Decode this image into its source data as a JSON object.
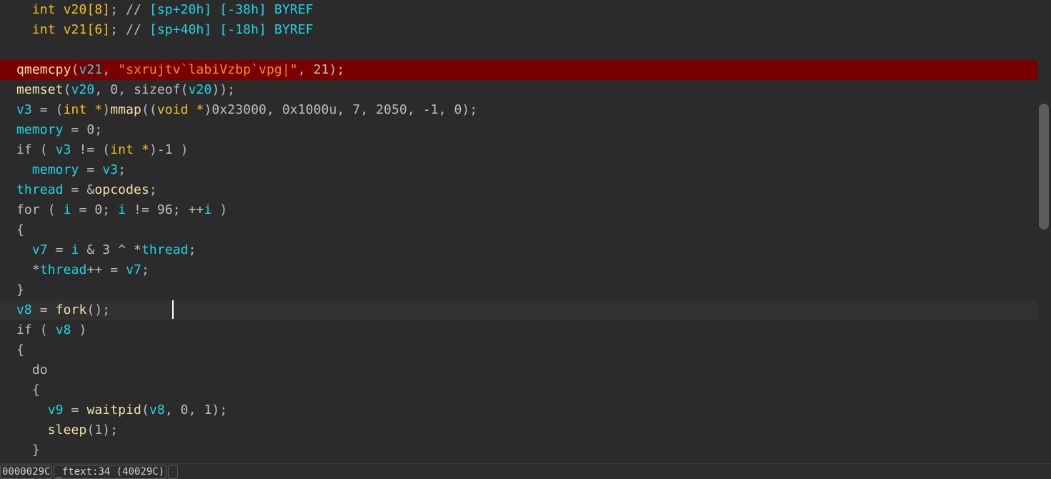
{
  "colors": {
    "keyword": "#f2c21a",
    "identifier": "#1fd6e6",
    "function": "#f2e3a8",
    "plain": "#bdbdbd",
    "string": "#ff8a1c",
    "highlight": "#7a0000",
    "background": "#2b2b2b"
  },
  "highlighted_line": 3,
  "cursor_line": 15,
  "lines": [
    [
      [
        "",
        "  "
      ],
      [
        "k",
        "int "
      ],
      [
        "k",
        "v20"
      ],
      [
        "k",
        "[8]"
      ],
      [
        "p",
        "; "
      ],
      [
        "c",
        "// "
      ],
      [
        "v",
        "[sp+20h] [-38h] BYREF"
      ]
    ],
    [
      [
        "",
        "  "
      ],
      [
        "k",
        "int "
      ],
      [
        "k",
        "v21"
      ],
      [
        "k",
        "[6]"
      ],
      [
        "p",
        "; "
      ],
      [
        "c",
        "// "
      ],
      [
        "v",
        "[sp+40h] [-18h] BYREF"
      ]
    ],
    [],
    [
      [
        "f",
        "qmemcpy"
      ],
      [
        "p",
        "("
      ],
      [
        "v",
        "v21"
      ],
      [
        "p",
        ", "
      ],
      [
        "s",
        "\"sxrujtv`labiVzbp`vpg|\""
      ],
      [
        "p",
        ", 21);"
      ]
    ],
    [
      [
        "f",
        "memset"
      ],
      [
        "p",
        "("
      ],
      [
        "v",
        "v20"
      ],
      [
        "p",
        ", 0, "
      ],
      [
        "p",
        "sizeof("
      ],
      [
        "v",
        "v20"
      ],
      [
        "p",
        "));"
      ]
    ],
    [
      [
        "v",
        "v3"
      ],
      [
        "p",
        " = ("
      ],
      [
        "k",
        "int *"
      ],
      [
        "p",
        ")"
      ],
      [
        "f",
        "mmap"
      ],
      [
        "p",
        "(("
      ],
      [
        "k",
        "void *"
      ],
      [
        "p",
        ")0x23000, 0x1000u, 7, 2050, -1, 0);"
      ]
    ],
    [
      [
        "v",
        "memory"
      ],
      [
        "p",
        " = 0;"
      ]
    ],
    [
      [
        "w",
        "if"
      ],
      [
        "p",
        " ( "
      ],
      [
        "v",
        "v3"
      ],
      [
        "p",
        " != ("
      ],
      [
        "k",
        "int *"
      ],
      [
        "p",
        ")-1 )"
      ]
    ],
    [
      [
        "p",
        "  "
      ],
      [
        "v",
        "memory"
      ],
      [
        "p",
        " = "
      ],
      [
        "v",
        "v3"
      ],
      [
        "p",
        ";"
      ]
    ],
    [
      [
        "v",
        "thread"
      ],
      [
        "p",
        " = &"
      ],
      [
        "f",
        "opcodes"
      ],
      [
        "p",
        ";"
      ]
    ],
    [
      [
        "w",
        "for"
      ],
      [
        "p",
        " ( "
      ],
      [
        "v",
        "i"
      ],
      [
        "p",
        " = 0; "
      ],
      [
        "v",
        "i"
      ],
      [
        "p",
        " != 96; ++"
      ],
      [
        "v",
        "i"
      ],
      [
        "p",
        " )"
      ]
    ],
    [
      [
        "p",
        "{"
      ]
    ],
    [
      [
        "p",
        "  "
      ],
      [
        "v",
        "v7"
      ],
      [
        "p",
        " = "
      ],
      [
        "v",
        "i"
      ],
      [
        "p",
        " & 3 ^ *"
      ],
      [
        "v",
        "thread"
      ],
      [
        "p",
        ";"
      ]
    ],
    [
      [
        "p",
        "  *"
      ],
      [
        "v",
        "thread"
      ],
      [
        "p",
        "++ = "
      ],
      [
        "v",
        "v7"
      ],
      [
        "p",
        ";"
      ]
    ],
    [
      [
        "p",
        "}"
      ]
    ],
    [
      [
        "v",
        "v8"
      ],
      [
        "p",
        " = "
      ],
      [
        "f",
        "fork"
      ],
      [
        "p",
        "();"
      ]
    ],
    [
      [
        "w",
        "if"
      ],
      [
        "p",
        " ( "
      ],
      [
        "v",
        "v8"
      ],
      [
        "p",
        " )"
      ]
    ],
    [
      [
        "p",
        "{"
      ]
    ],
    [
      [
        "w",
        "  do"
      ]
    ],
    [
      [
        "p",
        "  {"
      ]
    ],
    [
      [
        "p",
        "    "
      ],
      [
        "v",
        "v9"
      ],
      [
        "p",
        " = "
      ],
      [
        "f",
        "waitpid"
      ],
      [
        "p",
        "("
      ],
      [
        "v",
        "v8"
      ],
      [
        "p",
        ", 0, 1);"
      ]
    ],
    [
      [
        "p",
        "    "
      ],
      [
        "f",
        "sleep"
      ],
      [
        "p",
        "(1);"
      ]
    ],
    [
      [
        "p",
        "  }"
      ]
    ]
  ],
  "status": {
    "address": "0000029C",
    "location": "_ftext:34 (40029C)",
    "extra": ""
  }
}
